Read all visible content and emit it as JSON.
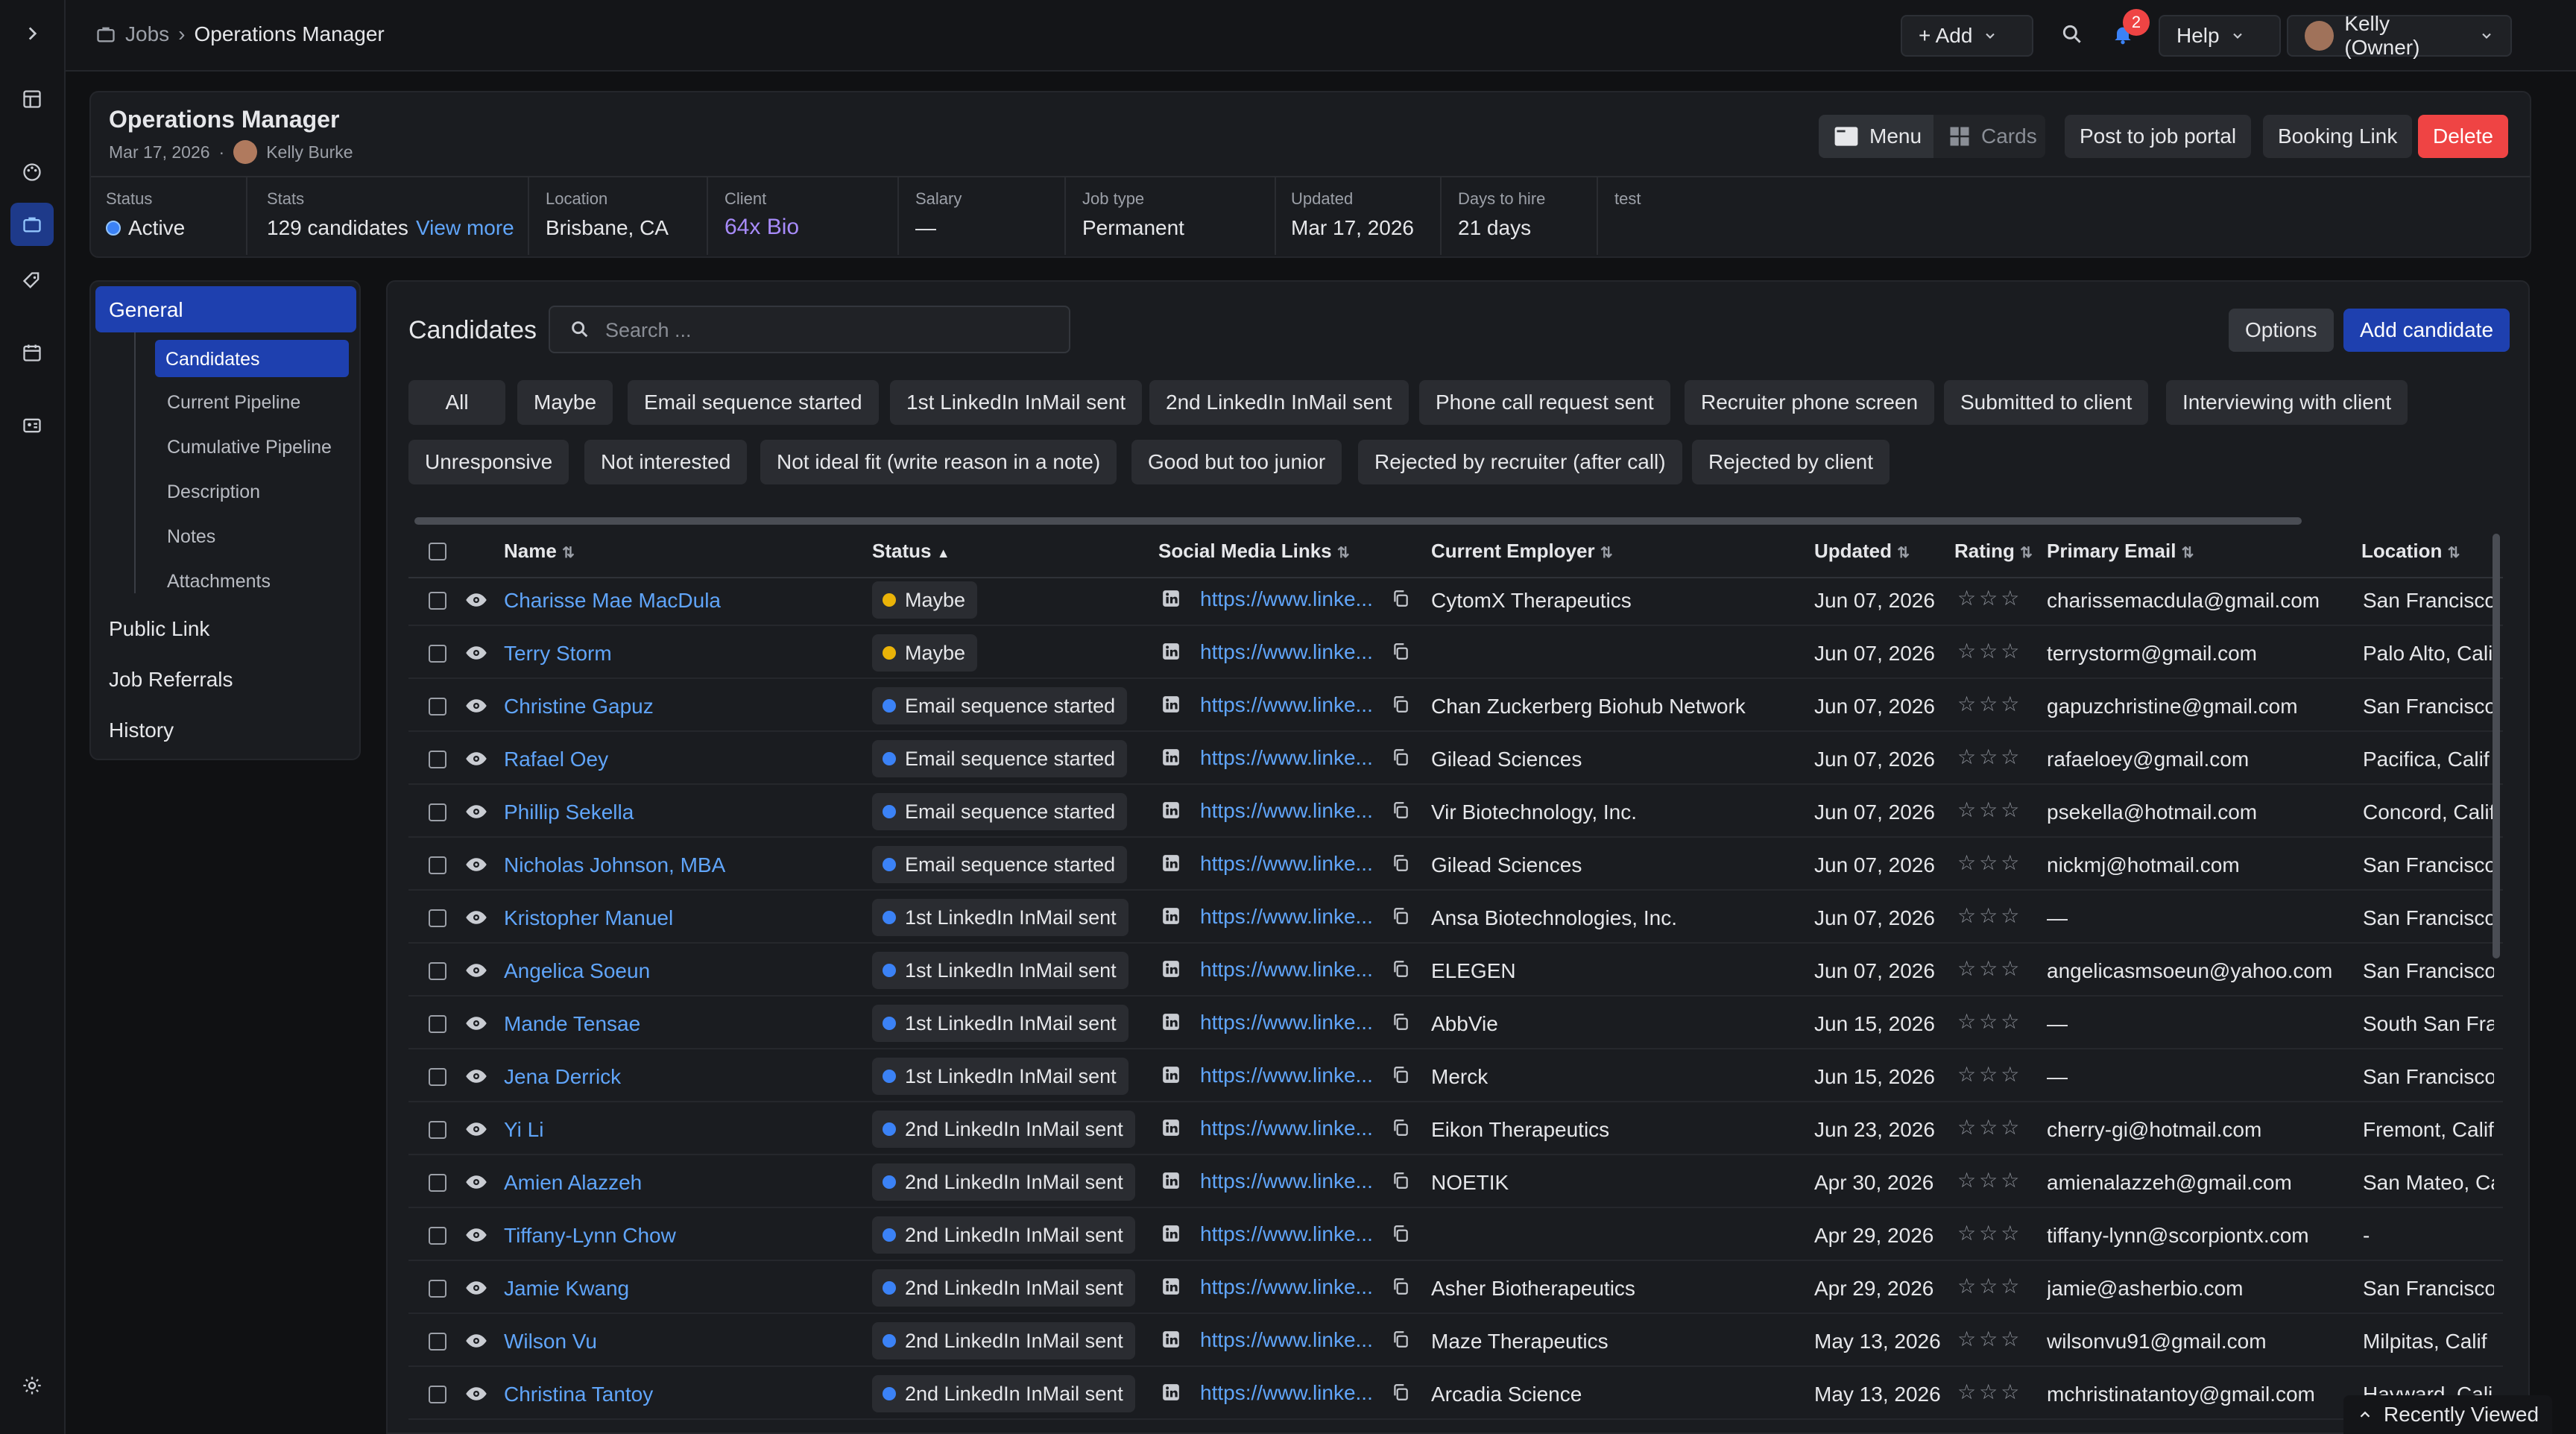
{
  "colors": {
    "accent": "#1e40af",
    "link": "#60a5fa",
    "delete": "#ef4444",
    "maybe": "#eab308",
    "status_blue": "#3b82f6",
    "client_purple": "#a78bfa"
  },
  "rail": {
    "icons": [
      "expand-icon",
      "dashboard-icon",
      "palette-icon",
      "briefcase-icon",
      "tag-icon",
      "calendar-icon",
      "contact-card-icon",
      "settings-icon"
    ]
  },
  "breadcrumb": {
    "root": "Jobs",
    "current": "Operations Manager"
  },
  "topbar": {
    "add_label": "+ Add",
    "notifications_count": "2",
    "help_label": "Help",
    "user_label": "Kelly (Owner)"
  },
  "job": {
    "title": "Operations Manager",
    "date": "Mar 17, 2026",
    "owner": "Kelly Burke",
    "buttons": {
      "menu": "Menu",
      "cards": "Cards",
      "post": "Post to job portal",
      "booking": "Booking Link",
      "delete": "Delete"
    },
    "stats": {
      "status_label": "Status",
      "status_value": "Active",
      "stats_label": "Stats",
      "stats_value": "129 candidates",
      "view_more": "View more",
      "location_label": "Location",
      "location_value": "Brisbane, CA",
      "client_label": "Client",
      "client_value": "64x Bio",
      "salary_label": "Salary",
      "salary_value": "—",
      "jobtype_label": "Job type",
      "jobtype_value": "Permanent",
      "updated_label": "Updated",
      "updated_value": "Mar 17, 2026",
      "days_label": "Days to hire",
      "days_value": "21 days",
      "test_label": "test"
    }
  },
  "sidenav": {
    "general": "General",
    "sub": [
      "Candidates",
      "Current Pipeline",
      "Cumulative Pipeline",
      "Description",
      "Notes",
      "Attachments"
    ],
    "public_link": "Public Link",
    "job_referrals": "Job Referrals",
    "history": "History"
  },
  "candidates": {
    "title": "Candidates",
    "search_placeholder": "Search ...",
    "options": "Options",
    "add": "Add candidate",
    "filters_row1": [
      "All",
      "Maybe",
      "Email sequence started",
      "1st LinkedIn InMail sent",
      "2nd LinkedIn InMail sent",
      "Phone call request sent",
      "Recruiter phone screen",
      "Submitted to client",
      "Interviewing with client"
    ],
    "filters_row2": [
      "Unresponsive",
      "Not interested",
      "Not ideal fit (write reason in a note)",
      "Good but too junior",
      "Rejected by recruiter (after call)",
      "Rejected by client"
    ],
    "columns": {
      "name": "Name",
      "status": "Status",
      "social": "Social Media Links",
      "employer": "Current Employer",
      "updated": "Updated",
      "rating": "Rating",
      "email": "Primary Email",
      "location": "Location"
    },
    "rows": [
      {
        "name": "Charisse Mae MacDula",
        "status": "Maybe",
        "link": "https://www.linke...",
        "employer": "CytomX Therapeutics",
        "updated": "Jun 07, 2026",
        "email": "charissemacdula@gmail.com",
        "location": "San Francisco"
      },
      {
        "name": "Terry Storm",
        "status": "Maybe",
        "link": "https://www.linke...",
        "employer": "",
        "updated": "Jun 07, 2026",
        "email": "terrystorm@gmail.com",
        "location": "Palo Alto, Cali"
      },
      {
        "name": "Christine Gapuz",
        "status": "Email sequence started",
        "link": "https://www.linke...",
        "employer": "Chan Zuckerberg Biohub Network",
        "updated": "Jun 07, 2026",
        "email": "gapuzchristine@gmail.com",
        "location": "San Francisco"
      },
      {
        "name": "Rafael Oey",
        "status": "Email sequence started",
        "link": "https://www.linke...",
        "employer": "Gilead Sciences",
        "updated": "Jun 07, 2026",
        "email": "rafaeloey@gmail.com",
        "location": "Pacifica, Calif"
      },
      {
        "name": "Phillip Sekella",
        "status": "Email sequence started",
        "link": "https://www.linke...",
        "employer": "Vir Biotechnology, Inc.",
        "updated": "Jun 07, 2026",
        "email": "psekella@hotmail.com",
        "location": "Concord, Calif"
      },
      {
        "name": "Nicholas Johnson, MBA",
        "status": "Email sequence started",
        "link": "https://www.linke...",
        "employer": "Gilead Sciences",
        "updated": "Jun 07, 2026",
        "email": "nickmj@hotmail.com",
        "location": "San Francisco"
      },
      {
        "name": "Kristopher Manuel",
        "status": "1st LinkedIn InMail sent",
        "link": "https://www.linke...",
        "employer": "Ansa Biotechnologies, Inc.",
        "updated": "Jun 07, 2026",
        "email": "—",
        "location": "San Francisco"
      },
      {
        "name": "Angelica Soeun",
        "status": "1st LinkedIn InMail sent",
        "link": "https://www.linke...",
        "employer": "ELEGEN",
        "updated": "Jun 07, 2026",
        "email": "angelicasmsoeun@yahoo.com",
        "location": "San Francisco"
      },
      {
        "name": "Mande Tensae",
        "status": "1st LinkedIn InMail sent",
        "link": "https://www.linke...",
        "employer": "AbbVie",
        "updated": "Jun 15, 2026",
        "email": "—",
        "location": "South San Fra"
      },
      {
        "name": "Jena Derrick",
        "status": "1st LinkedIn InMail sent",
        "link": "https://www.linke...",
        "employer": "Merck",
        "updated": "Jun 15, 2026",
        "email": "—",
        "location": "San Francisco"
      },
      {
        "name": "Yi Li",
        "status": "2nd LinkedIn InMail sent",
        "link": "https://www.linke...",
        "employer": "Eikon Therapeutics",
        "updated": "Jun 23, 2026",
        "email": "cherry-gi@hotmail.com",
        "location": "Fremont, Calif"
      },
      {
        "name": "Amien Alazzeh",
        "status": "2nd LinkedIn InMail sent",
        "link": "https://www.linke...",
        "employer": "NOETIK",
        "updated": "Apr 30, 2026",
        "email": "amienalazzeh@gmail.com",
        "location": "San Mateo, Ca"
      },
      {
        "name": "Tiffany-Lynn Chow",
        "status": "2nd LinkedIn InMail sent",
        "link": "https://www.linke...",
        "employer": "",
        "updated": "Apr 29, 2026",
        "email": "tiffany-lynn@scorpiontx.com",
        "location": "-"
      },
      {
        "name": "Jamie Kwang",
        "status": "2nd LinkedIn InMail sent",
        "link": "https://www.linke...",
        "employer": "Asher Biotherapeutics",
        "updated": "Apr 29, 2026",
        "email": "jamie@asherbio.com",
        "location": "San Francisco"
      },
      {
        "name": "Wilson Vu",
        "status": "2nd LinkedIn InMail sent",
        "link": "https://www.linke...",
        "employer": "Maze Therapeutics",
        "updated": "May 13, 2026",
        "email": "wilsonvu91@gmail.com",
        "location": "Milpitas, Calif"
      },
      {
        "name": "Christina Tantoy",
        "status": "2nd LinkedIn InMail sent",
        "link": "https://www.linke...",
        "employer": "Arcadia Science",
        "updated": "May 13, 2026",
        "email": "mchristinatantoy@gmail.com",
        "location": "Hayward, Cali"
      }
    ]
  },
  "recently_viewed": "Recently Viewed"
}
